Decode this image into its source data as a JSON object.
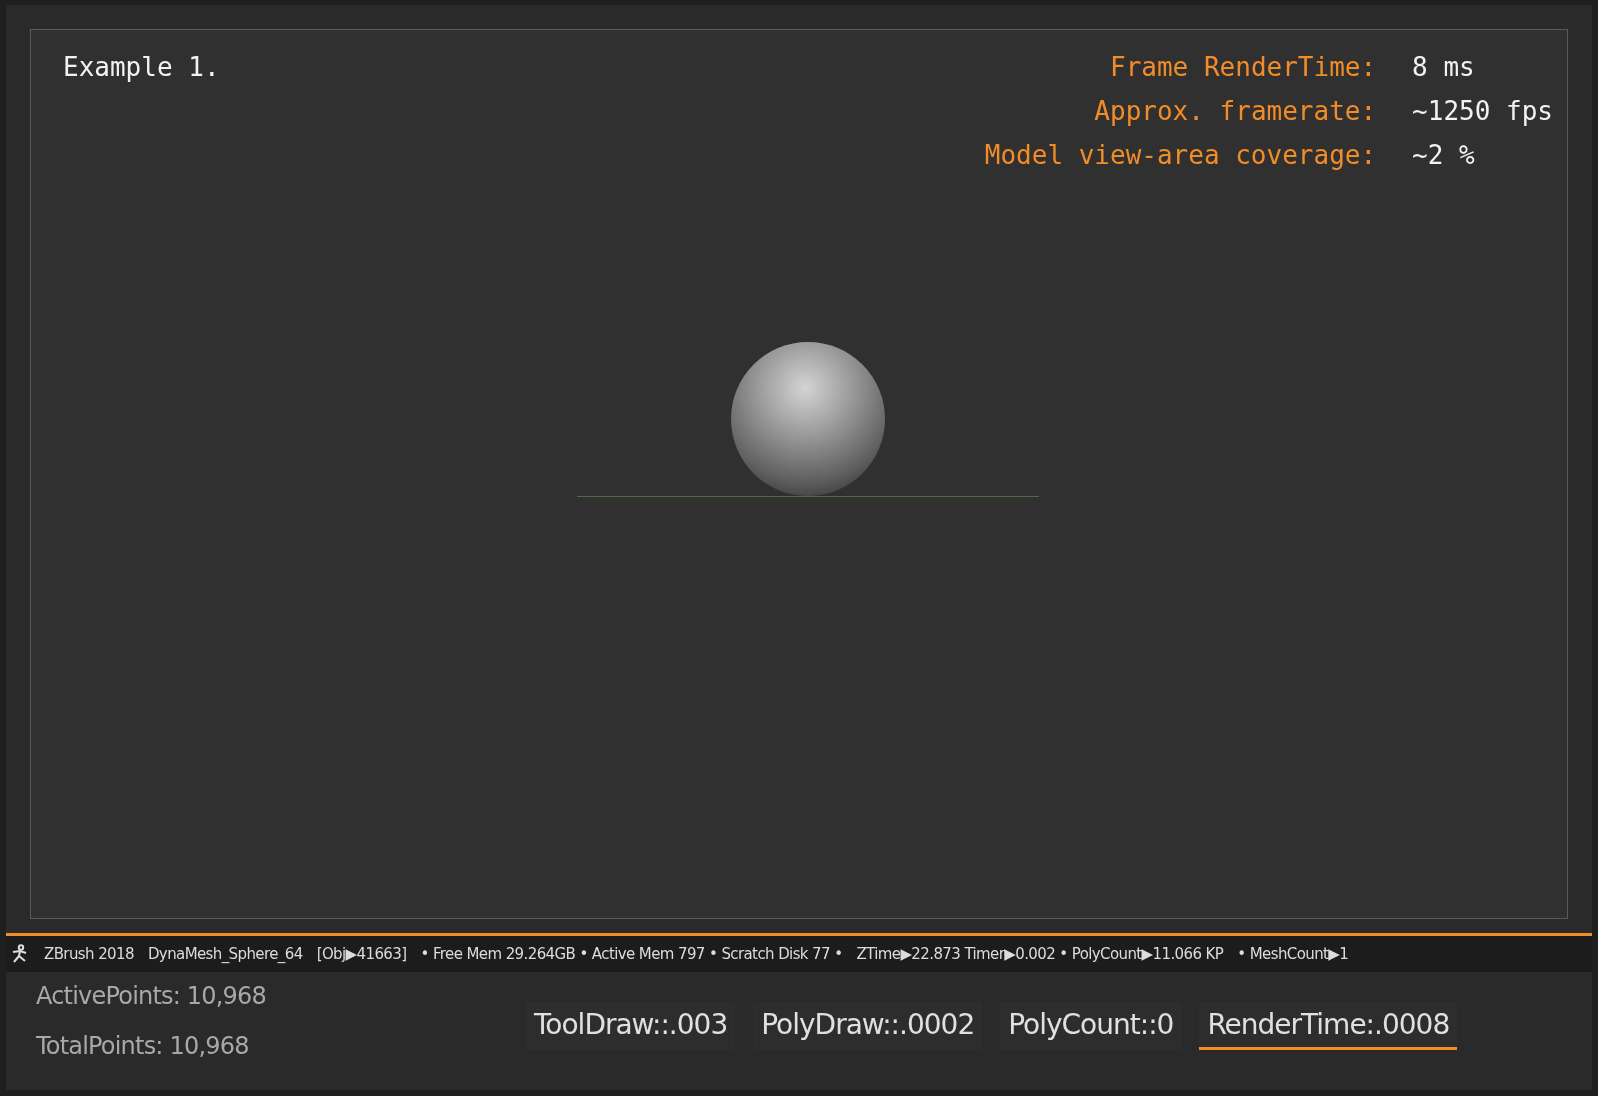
{
  "viewport": {
    "title": "Example 1.",
    "stats": [
      {
        "label": "Frame RenderTime:",
        "value": "8 ms"
      },
      {
        "label": "Approx. framerate:",
        "value": "~1250 fps"
      },
      {
        "label": "Model view-area coverage:",
        "value": "~2 %"
      }
    ]
  },
  "status_bar": {
    "items": [
      "ZBrush 2018",
      "DynaMesh_Sphere_64",
      "[Obj▶41663]",
      "• Free Mem 29.264GB • Active Mem 797 • Scratch Disk 77 •",
      "ZTime▶22.873 Timer▶0.002 • PolyCount▶11.066 KP",
      "• MeshCount▶1"
    ]
  },
  "points": [
    "ActivePoints: 10,968",
    "TotalPoints: 10,968"
  ],
  "metrics": [
    {
      "label": "ToolDraw::.003",
      "selected": false
    },
    {
      "label": "PolyDraw::.0002",
      "selected": false
    },
    {
      "label": "PolyCount::0",
      "selected": false
    },
    {
      "label": "RenderTime:.0008",
      "selected": true
    }
  ]
}
